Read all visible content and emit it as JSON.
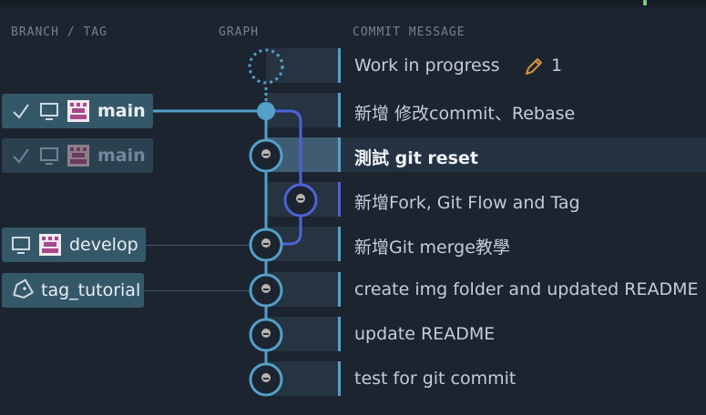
{
  "headers": {
    "branch": "BRANCH / TAG",
    "graph": "GRAPH",
    "message": "COMMIT MESSAGE"
  },
  "wip": {
    "message": "Work in progress",
    "edit_count": "1"
  },
  "commits": [
    {
      "message": "新增 修改commit、Rebase"
    },
    {
      "message": "測試 git reset"
    },
    {
      "message": "新增Fork, Git Flow and Tag"
    },
    {
      "message": "新增Git merge教學"
    },
    {
      "message": "create img folder and updated README"
    },
    {
      "message": "update README"
    },
    {
      "message": "test for git commit"
    }
  ],
  "refs": {
    "main_remote": "main",
    "main_local": "main",
    "develop": "develop",
    "tag": "tag_tutorial"
  },
  "colors": {
    "lane_main": "#53a0c9",
    "lane_branch": "#4d63d8",
    "accent_edit": "#d4913b"
  },
  "icons": [
    "check-icon",
    "computer-icon",
    "avatar-icon",
    "tag-icon",
    "pencil-icon"
  ]
}
